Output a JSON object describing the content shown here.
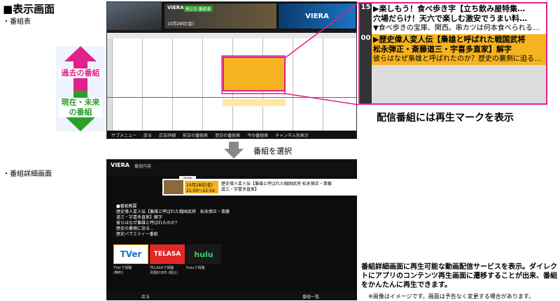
{
  "page": {
    "title": "■表示画面",
    "section1": "・番組表",
    "section2": "・番組詳細画面",
    "select_label": "番組を選択",
    "caption_replay": "配信番組には再生マークを表示",
    "description": "番組詳細画面に再生可能な動画配信サービスを表示。ダイレクトにアプリのコンテンツ再生画面に遷移することが出来、番組をかんたんに再生できます。",
    "note": "※画像はイメージです。画面は予告なく変更する場合があります。"
  },
  "arrows": {
    "past": "過去の番組",
    "now": "現在・未来の番組"
  },
  "epg": {
    "brand": "VIERA",
    "mode": "地上D 番組表",
    "date": "10月28日(金)",
    "ad": "VIERA",
    "bottom_items": [
      "サブメニュー",
      "戻る",
      "広告詳細",
      "前日の番組表",
      "翌日の番組表",
      "今の番組表",
      "チャンネル別表示"
    ]
  },
  "zoom": {
    "rows": [
      {
        "slot": "15",
        "line1": "▶楽しもう！食べ歩き字【立ち飲み屋特集…",
        "line2": "穴場だらけ！天六で楽しむ激安でうまい料…",
        "line3": "▼食べ歩きの宝庫、関西。串カツは何本食べられる…"
      },
      {
        "slot": "00",
        "line1": "▶歴史偉人変人伝【梟雄と呼ばれた戦国武将",
        "line2": "松永弾正・斎藤道三・宇喜多直家】解字",
        "line3": "彼らはなぜ梟雄と呼ばれたのか？歴史の裏側に迫る…"
      }
    ]
  },
  "detail": {
    "brand": "VIERA",
    "header": "番組内容",
    "tab": "内容",
    "prog_date": "10月28日(金)",
    "prog_time": "21:00〜22:54",
    "prog_title": "歴史偉人変人伝【梟雄と呼ばれた戦国武将 松永弾正・斎藤道三・宇喜多直家】",
    "summary_lines": [
      "■番組概要",
      "歴史偉人変人伝【梟雄と呼ばれた戦国武将　松永弾正・斎藤",
      "道三・宇喜多直家】解字",
      "彼らはなぜ梟雄と呼ばれたのか？",
      "歴史の裏側に迫る…",
      "歴史バラエティー番組"
    ],
    "services": [
      {
        "name": "TVer",
        "label1": "TVerで視聴",
        "label2": "(無料)"
      },
      {
        "name": "TELASA",
        "label1": "TELASAで視聴",
        "label2": "月額618円 (税込)"
      },
      {
        "name": "hulu",
        "label1": "Huluで視聴",
        "label2": ""
      }
    ],
    "bottom": [
      "戻る",
      "番組一覧"
    ]
  },
  "colors": {
    "accent": "#e0228a",
    "green": "#2aa02a",
    "highlight": "#f6b320"
  }
}
